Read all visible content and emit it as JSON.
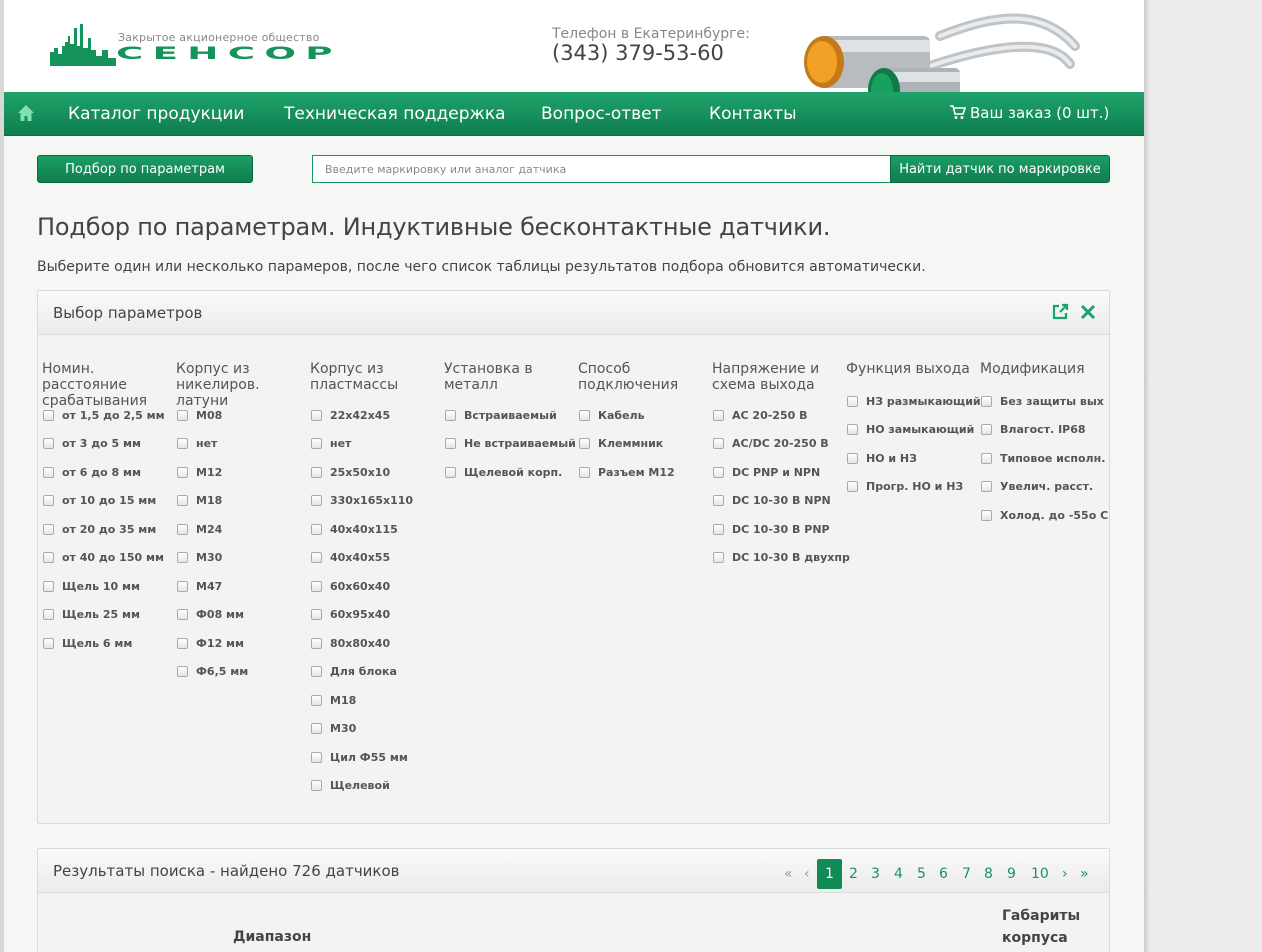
{
  "header": {
    "logo_subtitle": "Закрытое акционерное общество",
    "logo_name": "СЕНСОР",
    "phone_label": "Телефон в Екатеринбурге:",
    "phone_number": "(343) 379-53-60"
  },
  "nav": {
    "home_icon": "home-icon",
    "items": [
      "Каталог продукции",
      "Техническая поддержка",
      "Вопрос-ответ",
      "Контакты"
    ],
    "cart_label": "Ваш заказ (0 шт.)"
  },
  "toolbar": {
    "param_button": "Подбор по параметрам",
    "search_placeholder": "Введите маркировку или аналог датчика",
    "search_button": "Найти датчик по маркировке"
  },
  "page": {
    "title": "Подбор по параметрам. Индуктивные бесконтактные датчики.",
    "description": "Выберите один или несколько парамеров, после чего список таблицы результатов подбора обновится автоматически."
  },
  "params": {
    "title": "Выбор параметров",
    "columns": [
      {
        "title": "Номин. расстояние срабатывания",
        "options": [
          "от 1,5 до 2,5 мм",
          "от 3 до 5 мм",
          "от 6 до 8 мм",
          "от 10 до 15 мм",
          "от 20 до 35 мм",
          "от 40 до 150 мм",
          "Щель 10 мм",
          "Щель 25 мм",
          "Щель 6 мм"
        ]
      },
      {
        "title": "Корпус из никелиров. латуни",
        "options": [
          "М08",
          "нет",
          "М12",
          "М18",
          "М24",
          "М30",
          "М47",
          "Ф08 мм",
          "Ф12 мм",
          "Ф6,5 мм"
        ]
      },
      {
        "title": "Корпус из пластмассы",
        "options": [
          "22x42x45",
          "нет",
          "25x50x10",
          "330x165x110",
          "40x40x115",
          "40x40x55",
          "60x60x40",
          "60x95x40",
          "80x80x40",
          "Для блока",
          "М18",
          "М30",
          "Цил Ф55 мм",
          "Щелевой"
        ]
      },
      {
        "title": "Установка в металл",
        "options": [
          "Встраиваемый",
          "Не встраиваемый",
          "Щелевой корп."
        ]
      },
      {
        "title": "Способ подключения",
        "options": [
          "Кабель",
          "Клеммник",
          "Разъем М12"
        ]
      },
      {
        "title": "Напряжение и схема выхода",
        "options": [
          "AC 20-250 В",
          "AC/DC 20-250 В",
          "DC PNP и NPN",
          "DC 10-30 В NPN",
          "DC 10-30 В PNP",
          "DC 10-30 В двухпр"
        ]
      },
      {
        "title": "Функция выхода",
        "options": [
          "НЗ размыкающий",
          "НО замыкающий",
          "НО и НЗ",
          "Прогр. НО и НЗ"
        ]
      },
      {
        "title": "Модификация",
        "options": [
          "Без защиты вых",
          "Влагост. IP68",
          "Типовое исполн.",
          "Увелич. расст.",
          "Холод. до -55o С"
        ]
      }
    ]
  },
  "results": {
    "title": "Результаты поиска - найдено 726 датчиков",
    "pager": {
      "first": "«",
      "prev": "‹",
      "pages": [
        "1",
        "2",
        "3",
        "4",
        "5",
        "6",
        "7",
        "8",
        "9",
        "10"
      ],
      "current": "1",
      "next": "›",
      "last": "»"
    },
    "table_headers": [
      "Диапазон",
      "Габариты корпуса"
    ]
  },
  "colors": {
    "accent": "#128a55",
    "nav": "#15915c"
  }
}
